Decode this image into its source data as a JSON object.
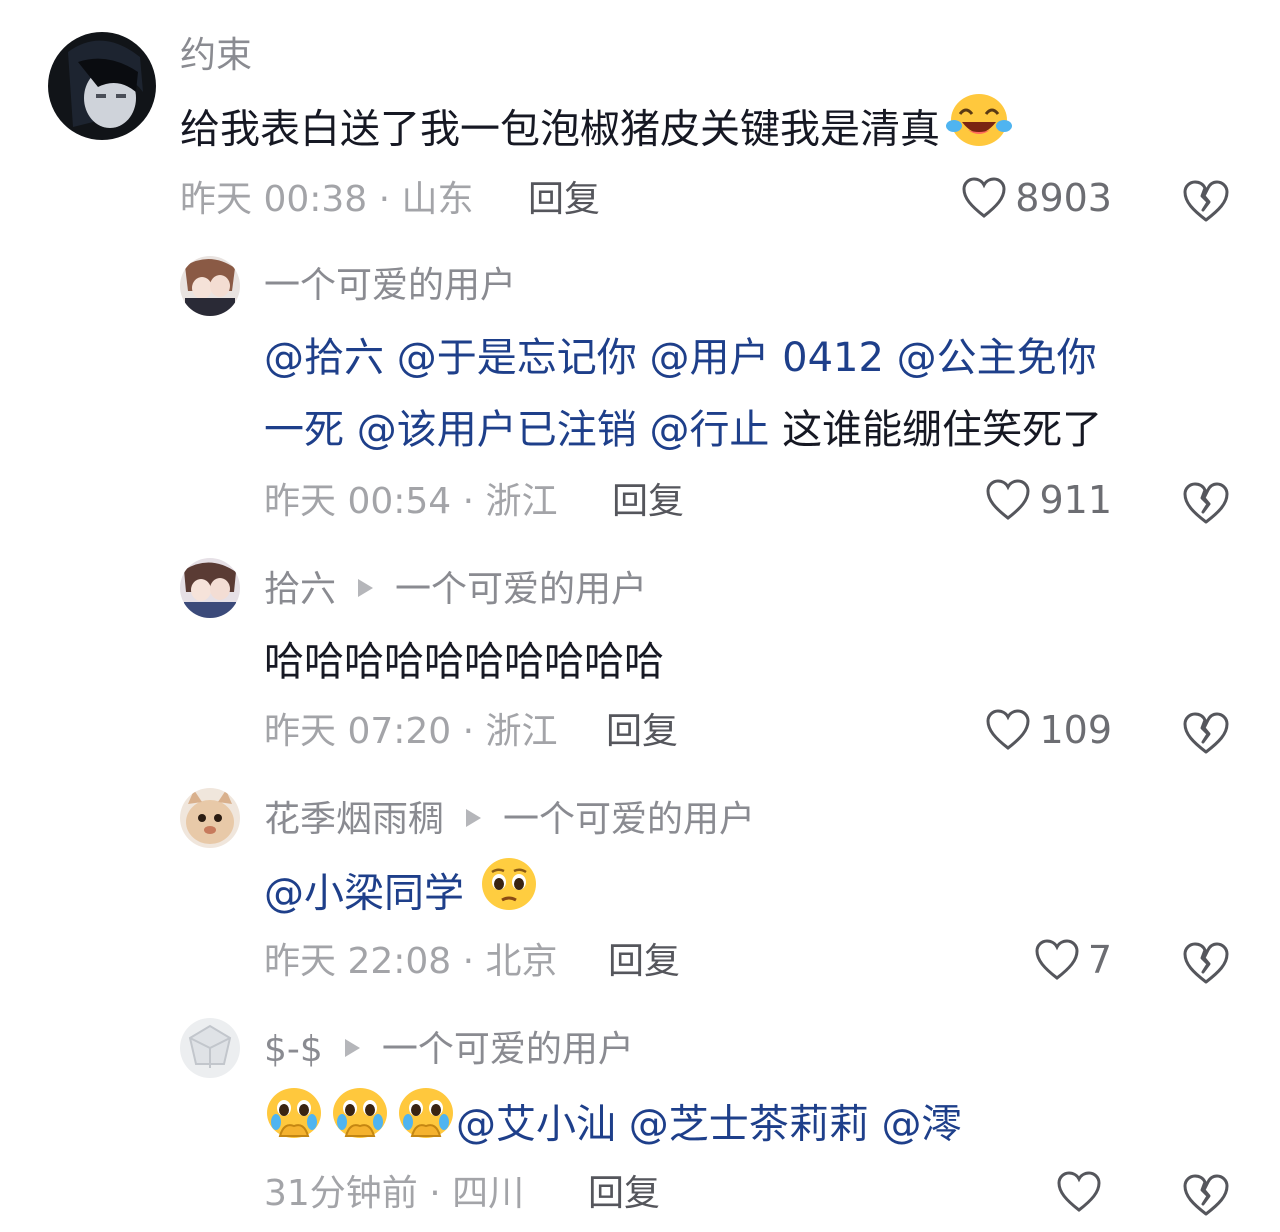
{
  "comments": [
    {
      "username": "约束",
      "text_parts": [
        {
          "text": "给我表白送了我一包泡椒猪皮关键我是清真",
          "mention": false
        }
      ],
      "trailing_emoji": "laugh-cry-emoji",
      "time_location": "昨天 00:38 · 山东",
      "reply_label": "回复",
      "likes": "8903"
    },
    {
      "username": "一个可爱的用户",
      "line1": [
        {
          "text": "@拾六 ",
          "mention": true
        },
        {
          "text": "@于是忘记你 ",
          "mention": true
        },
        {
          "text": "@用户 0412 ",
          "mention": true
        },
        {
          "text": "@公主免你",
          "mention": true
        }
      ],
      "line2": [
        {
          "text": "一死 ",
          "mention": true
        },
        {
          "text": "@该用户已注销 ",
          "mention": true
        },
        {
          "text": "@行止",
          "mention": true
        },
        {
          "text": " 这谁能绷住笑死了",
          "mention": false
        }
      ],
      "time_location": "昨天 00:54 · 浙江",
      "reply_label": "回复",
      "likes": "911"
    },
    {
      "username": "拾六",
      "reply_to": "一个可爱的用户",
      "text": "哈哈哈哈哈哈哈哈哈哈",
      "time_location": "昨天 07:20 · 浙江",
      "reply_label": "回复",
      "likes": "109"
    },
    {
      "username": "花季烟雨稠",
      "reply_to": "一个可爱的用户",
      "text": "@小梁同学",
      "trailing_emoji": "pleading-face-emoji",
      "time_location": "昨天 22:08 · 北京",
      "reply_label": "回复",
      "likes": "7"
    },
    {
      "username": "$-$",
      "reply_to": "一个可爱的用户",
      "leading_emojis": [
        "crying-hands-emoji",
        "crying-hands-emoji",
        "crying-hands-emoji"
      ],
      "text_parts": [
        {
          "text": "@艾小汕 ",
          "mention": true
        },
        {
          "text": "@芝士茶莉莉 ",
          "mention": true
        },
        {
          "text": "@澪",
          "mention": true
        }
      ],
      "time_location": "31分钟前 · 四川",
      "reply_label": "回复",
      "likes": ""
    }
  ],
  "colors": {
    "mention": "#1e3f8a",
    "username": "#8a8b91",
    "meta": "#a3a4a8",
    "text": "#161823"
  }
}
